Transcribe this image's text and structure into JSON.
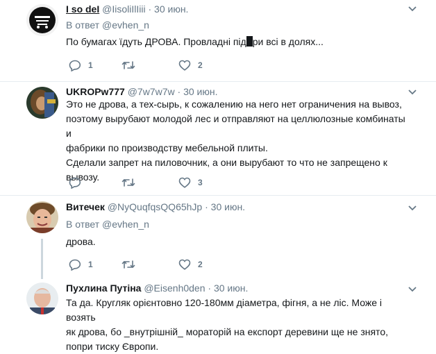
{
  "tweets": [
    {
      "name": "I so deI",
      "handle": "@IisoliIlIiii",
      "sep": "·",
      "time": "30 июн.",
      "reply_to": "В ответ @evhen_n",
      "text_before": "По бумагах їдуть ДРОВА.  Провладні під",
      "text_after": "ри всі в долях...",
      "replies": "1",
      "retweets": "",
      "likes": "2"
    },
    {
      "name": "UKROPw777",
      "handle": "@7w7w7w",
      "sep": "·",
      "time": "30 июн.",
      "lines": [
        "Это не дрова, а тех-сырь, к сожалению на него нет ограничения на вывоз,",
        "поэтому вырубают молодой лес и отправляют на целлюлозные комбинаты и",
        "фабрики по производству мебельной плиты.",
        "Сделали запрет на пиловочник, а они вырубают то что не запрещено к",
        "вывозу."
      ],
      "replies": "",
      "retweets": "",
      "likes": "3"
    },
    {
      "name": "Витечек",
      "handle": "@NyQuqfqsQQ65hJp",
      "sep": "·",
      "time": "30 июн.",
      "reply_to": "В ответ @evhen_n",
      "text": "дрова.",
      "replies": "1",
      "retweets": "",
      "likes": "2"
    },
    {
      "name": "Пухлина Путіна",
      "handle": "@Eisenh0den",
      "sep": "·",
      "time": "30 июн.",
      "lines": [
        "Та да. Кругляк орієнтовно 120-180мм діаметра, фігня, а не ліс. Може і возять",
        "як дрова, бо _внутрішній_ мораторій на експорт деревини ще не знято,",
        "попри тиску Європи."
      ]
    }
  ],
  "colors": {
    "text": "#14171a",
    "secondary": "#657786",
    "line": "#ccd6dd",
    "border": "#e6ecf0"
  }
}
